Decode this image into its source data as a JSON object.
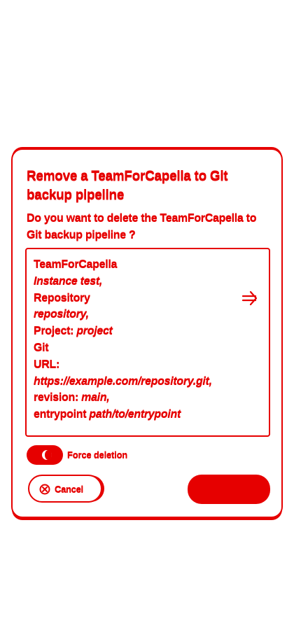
{
  "dialog": {
    "title": "Remove a TeamForCapella to Git backup pipeline",
    "question": "Do you want to delete the TeamForCapella to Git backup pipeline ?"
  },
  "details": {
    "header": "TeamForCapella",
    "instance": "Instance test,",
    "repository_label": "Repository",
    "repository_value": "repository,",
    "project_label": "Project:",
    "project_value": "project",
    "git_label": "Git",
    "url_label": "URL:",
    "url_value": "https://example.com/repository.git,",
    "revision_label": "revision:",
    "revision_value": "main,",
    "entrypoint_label": "entrypoint",
    "entrypoint_value": "path/to/entrypoint",
    "arrow_icon": "arrow-right-icon"
  },
  "force": {
    "label": "Force deletion",
    "enabled": true
  },
  "actions": {
    "cancel_label": "Cancel",
    "cancel_icon": "cancel-circle-icon",
    "confirm_label": ""
  },
  "colors": {
    "accent": "#e60000",
    "background": "#ffffff"
  }
}
